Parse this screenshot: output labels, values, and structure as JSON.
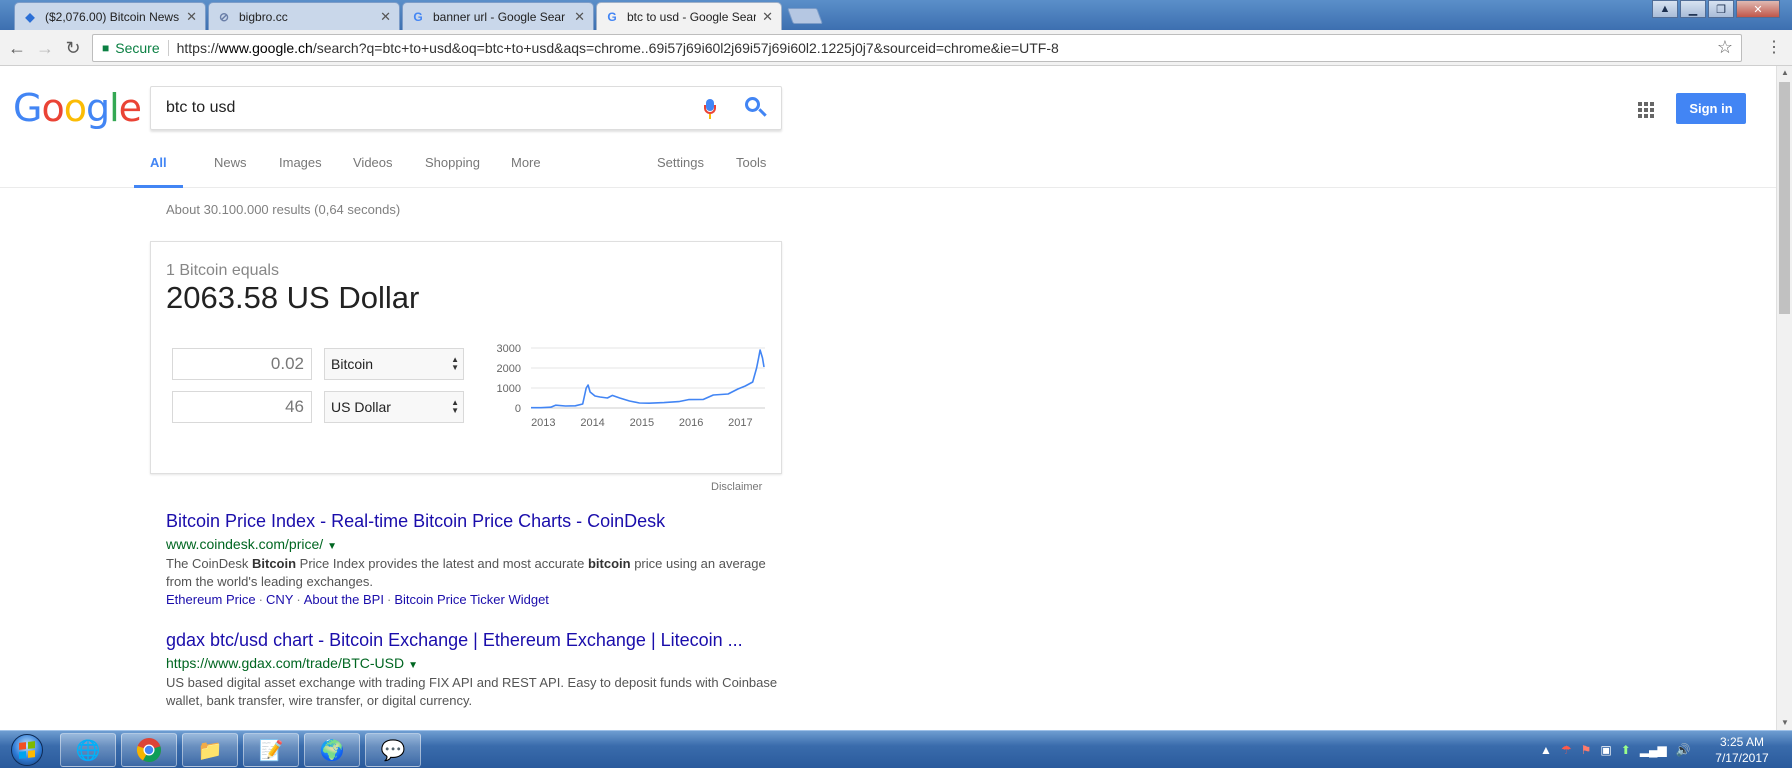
{
  "browser": {
    "tabs": [
      {
        "title": "($2,076.00) Bitcoin News",
        "favicon": "bitcoin-diamond-icon",
        "active": false
      },
      {
        "title": "bigbro.cc",
        "favicon": "link-icon",
        "active": false
      },
      {
        "title": "banner url - Google Sear",
        "favicon": "google-g-icon",
        "active": false
      },
      {
        "title": "btc to usd - Google Sear",
        "favicon": "google-g-icon",
        "active": true
      }
    ],
    "secure_label": "Secure",
    "url_scheme": "https://",
    "url_host": "www.google.ch",
    "url_path": "/search?q=btc+to+usd&oq=btc+to+usd&aqs=chrome..69i57j69i60l2j69i57j69i60l2.1225j0j7&sourceid=chrome&ie=UTF-8"
  },
  "google": {
    "logo_letters": [
      "G",
      "o",
      "o",
      "g",
      "l",
      "e"
    ],
    "logo_colors": [
      "#4285f4",
      "#ea4335",
      "#fbbc05",
      "#4285f4",
      "#34a853",
      "#ea4335"
    ],
    "query": "btc to usd",
    "sign_in": "Sign in",
    "nav": [
      "All",
      "News",
      "Images",
      "Videos",
      "Shopping",
      "More"
    ],
    "nav_right": [
      "Settings",
      "Tools"
    ],
    "result_stats": "About 30.100.000 results (0,64 seconds)"
  },
  "converter": {
    "equals_text": "1 Bitcoin equals",
    "rate_text": "2063.58 US Dollar",
    "from_amount": "0.02",
    "from_currency": "Bitcoin",
    "to_amount": "46",
    "to_currency": "US Dollar",
    "disclaimer": "Disclaimer"
  },
  "chart_data": {
    "type": "line",
    "title": "",
    "xlabel": "",
    "ylabel": "",
    "x_ticks": [
      "2013",
      "2014",
      "2015",
      "2016",
      "2017"
    ],
    "y_ticks": [
      "0",
      "1000",
      "2000",
      "3000"
    ],
    "ylim": [
      0,
      3000
    ],
    "xlim": [
      2012.8,
      2017.55
    ],
    "grid": true,
    "line_color": "#4285f4",
    "series": [
      {
        "x": [
          2012.8,
          2013.0,
          2013.2,
          2013.3,
          2013.5,
          2013.7,
          2013.85,
          2013.92,
          2013.96,
          2014.0,
          2014.1,
          2014.2,
          2014.35,
          2014.45,
          2014.6,
          2014.8,
          2015.0,
          2015.2,
          2015.5,
          2015.8,
          2016.0,
          2016.3,
          2016.5,
          2016.8,
          2017.0,
          2017.15,
          2017.3,
          2017.38,
          2017.42,
          2017.45,
          2017.5,
          2017.53
        ],
        "y": [
          13,
          15,
          40,
          140,
          100,
          110,
          200,
          1000,
          1150,
          800,
          600,
          550,
          500,
          630,
          500,
          350,
          250,
          240,
          270,
          320,
          420,
          430,
          650,
          700,
          950,
          1100,
          1300,
          2000,
          2500,
          2900,
          2500,
          2050
        ]
      }
    ]
  },
  "results": [
    {
      "title": "Bitcoin Price Index - Real-time Bitcoin Price Charts - CoinDesk",
      "url": "www.coindesk.com/price/",
      "snippet_1": "The CoinDesk ",
      "snippet_b1": "Bitcoin",
      "snippet_2": " Price Index provides the latest and most accurate ",
      "snippet_b2": "bitcoin",
      "snippet_3": " price using an average from the world's leading exchanges.",
      "sitelinks": [
        "Ethereum Price",
        "CNY",
        "About the BPI",
        "Bitcoin Price Ticker Widget"
      ]
    },
    {
      "title": "gdax btc/usd chart - Bitcoin Exchange | Ethereum Exchange | Litecoin ...",
      "url": "https://www.gdax.com/trade/BTC-USD",
      "snippet": "US based digital asset exchange with trading FIX API and REST API. Easy to deposit funds with Coinbase wallet, bank transfer, wire transfer, or digital currency."
    }
  ],
  "taskbar": {
    "apps": [
      "globe-icon",
      "chrome-icon",
      "folder-icon",
      "notepad-icon",
      "network-globe-icon",
      "chat-bird-icon"
    ],
    "time": "3:25 AM",
    "date": "7/17/2017"
  }
}
